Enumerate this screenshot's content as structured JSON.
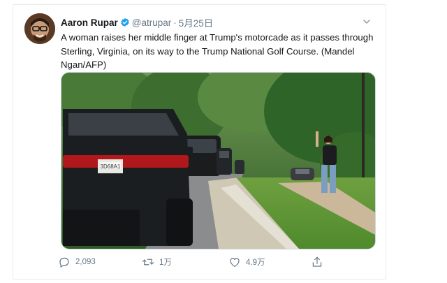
{
  "tweet": {
    "author_name": "Aaron Rupar",
    "handle": "@atrupar",
    "separator": "·",
    "date": "5月25日",
    "text": "A woman raises her middle finger at Trump's motorcade as it passes through Sterling, Virginia, on its way to the Trump National Golf Course. (Mandel Ngan/AFP)",
    "verified_icon": "verified-badge-icon",
    "menu_icon": "chevron-down-icon",
    "media_icon": "tweet-photo",
    "license_plate": "3D68A1"
  },
  "actions": {
    "reply_count": "2,093",
    "retweet_count": "1万",
    "like_count": "4.9万",
    "icons": [
      "reply-icon",
      "retweet-icon",
      "like-icon",
      "share-icon"
    ]
  },
  "colors": {
    "verified_blue": "#1da1f2",
    "text_primary": "#14171a",
    "text_secondary": "#657786",
    "border": "#e6ecf0"
  }
}
